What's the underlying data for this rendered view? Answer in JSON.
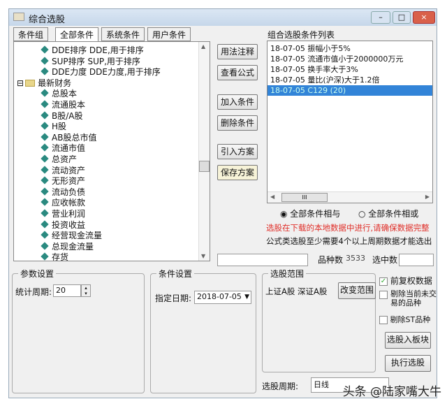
{
  "window": {
    "title": "综合选股",
    "min": "–",
    "max": "□",
    "close": "×"
  },
  "tabs": [
    "条件组",
    "全部条件",
    "系统条件",
    "用户条件"
  ],
  "tree": {
    "items": [
      {
        "label": "DDE排序 DDE,用于排序",
        "level": 2
      },
      {
        "label": "SUP排序 SUP,用于排序",
        "level": 2
      },
      {
        "label": "DDE力度 DDE力度,用于排序",
        "level": 2
      },
      {
        "label": "最新财务",
        "level": 1,
        "expanded": true
      },
      {
        "label": "总股本",
        "level": 2
      },
      {
        "label": "流通股本",
        "level": 2
      },
      {
        "label": "B股/A股",
        "level": 2
      },
      {
        "label": "H股",
        "level": 2
      },
      {
        "label": "AB股总市值",
        "level": 2
      },
      {
        "label": "流通市值",
        "level": 2
      },
      {
        "label": "总资产",
        "level": 2
      },
      {
        "label": "流动资产",
        "level": 2
      },
      {
        "label": "无形资产",
        "level": 2
      },
      {
        "label": "流动负债",
        "level": 2
      },
      {
        "label": "应收帐款",
        "level": 2
      },
      {
        "label": "营业利润",
        "level": 2
      },
      {
        "label": "投资收益",
        "level": 2
      },
      {
        "label": "经营现金流量",
        "level": 2
      },
      {
        "label": "总现金流量",
        "level": 2
      },
      {
        "label": "存货",
        "level": 2
      }
    ],
    "expander": "⊟"
  },
  "buttons": {
    "usage": "用法注释",
    "formula": "查看公式",
    "add": "加入条件",
    "delete": "删除条件",
    "import": "引入方案",
    "save": "保存方案",
    "to_block": "选股入板块",
    "execute": "执行选股",
    "change_range": "改变范围"
  },
  "conditions": {
    "title": "组合选股条件列表",
    "items": [
      "18-07-05 振幅小于5%",
      "18-07-05 流通市值小于2000000万元",
      "18-07-05 换手率大于3%",
      "18-07-05 量比(沪深)大于1.2倍",
      "18-07-05 C129 (20)"
    ],
    "selected_index": 4,
    "hscroll_grip": "III"
  },
  "logic": {
    "and_label": "全部条件相与",
    "or_label": "全部条件相或",
    "selected": "and"
  },
  "notes": {
    "warning": "选股在下载的本地数据中进行,请确保数据完整",
    "info": "公式类选股至少需要4个以上周期数据才能选出"
  },
  "stats": {
    "count_label": "品种数",
    "count": "3533",
    "selected_label": "选中数",
    "selected": ""
  },
  "params": {
    "legend": "参数设置",
    "period_label": "统计周期:",
    "period_value": "20"
  },
  "cond_settings": {
    "legend": "条件设置",
    "date_label": "指定日期:",
    "date_value": "2018-07-05"
  },
  "range": {
    "legend": "选股范围",
    "markets": "上证A股 深证A股"
  },
  "options": {
    "adjusted": {
      "label": "前复权数据",
      "checked": true
    },
    "exclude_untraded": {
      "label": "剔除当前未交易的品种",
      "checked": false
    },
    "exclude_st": {
      "label": "剔除ST品种",
      "checked": false
    }
  },
  "cycle": {
    "label": "选股周期:",
    "value": "日线"
  },
  "watermark": "头条 @陆家嘴大牛",
  "colors": {
    "selection": "#3284d8",
    "warning": "#e0302a"
  }
}
